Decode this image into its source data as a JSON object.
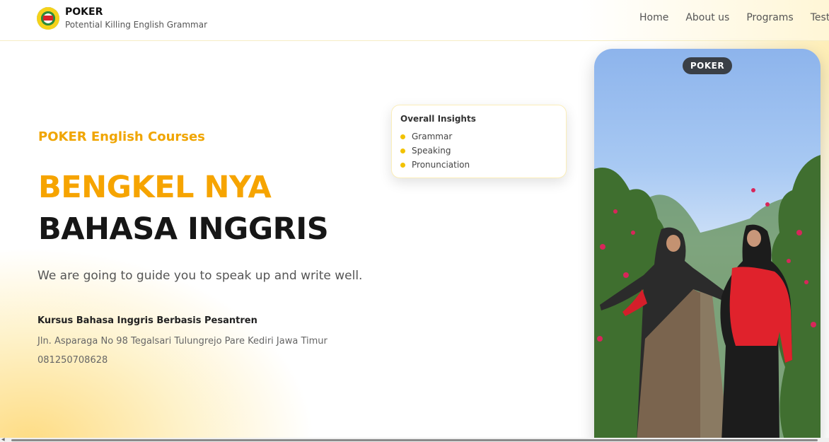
{
  "header": {
    "brand_name": "POKER",
    "brand_tagline": "Potential Killing English Grammar",
    "nav": [
      {
        "label": "Home"
      },
      {
        "label": "About us"
      },
      {
        "label": "Programs"
      },
      {
        "label": "Testim"
      }
    ]
  },
  "hero": {
    "eyebrow": "POKER English Courses",
    "headline_line1": "BENGKEL NYA",
    "headline_line2": "BAHASA INGGRIS",
    "subtitle": "We are going to guide you to speak up and write well.",
    "info_title": "Kursus Bahasa Inggris Berbasis Pesantren",
    "address": "Jln. Asparaga No 98 Tegalsari Tulungrejo Pare Kediri Jawa Timur",
    "phone": "081250708628"
  },
  "insights": {
    "title": "Overall Insights",
    "items": [
      {
        "label": "Grammar"
      },
      {
        "label": "Speaking"
      },
      {
        "label": "Pronunciation"
      }
    ]
  },
  "video": {
    "badge": "POKER"
  },
  "colors": {
    "accent": "#f6a400",
    "eyebrow": "#f0a500",
    "dot": "#f2c200",
    "dark": "#161616"
  }
}
